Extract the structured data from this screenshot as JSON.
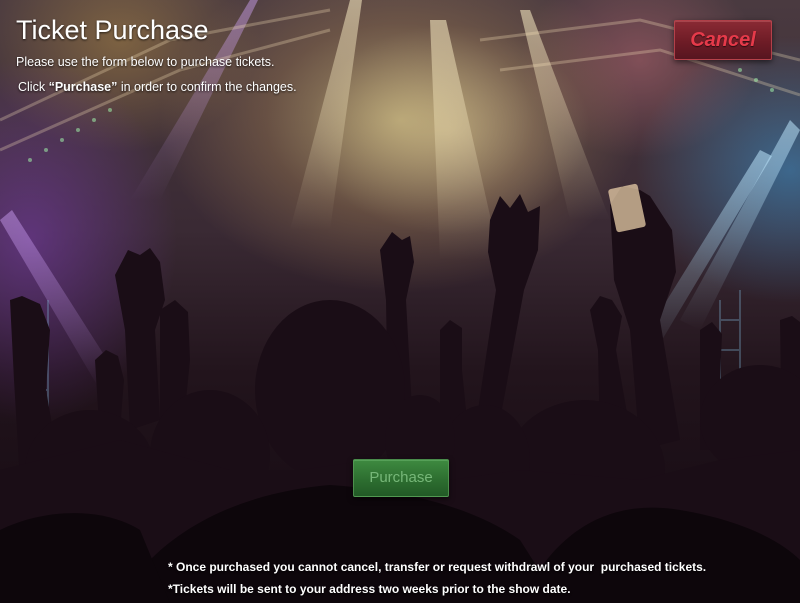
{
  "page": {
    "title": "Ticket Purchase",
    "intro": "Please use the form below to purchase tickets.",
    "instruction": {
      "prefix": "Click ",
      "emphasis": "“Purchase”",
      "suffix": " in order to confirm the changes."
    }
  },
  "buttons": {
    "cancel_label": "Cancel",
    "purchase_label": "Purchase"
  },
  "notes": [
    "* Once purchased you cannot cancel, transfer or request withdrawl of your  purchased tickets.",
    "*Tickets will be sent to your address two weeks prior to the show date."
  ],
  "background": {
    "description_icon": "concert-crowd-image"
  },
  "colors": {
    "cancel_bg": "#6e1c26",
    "cancel_text": "#e63a4a",
    "purchase_bg": "#2d6e30",
    "purchase_text": "#76b778",
    "text": "#ffffff"
  }
}
